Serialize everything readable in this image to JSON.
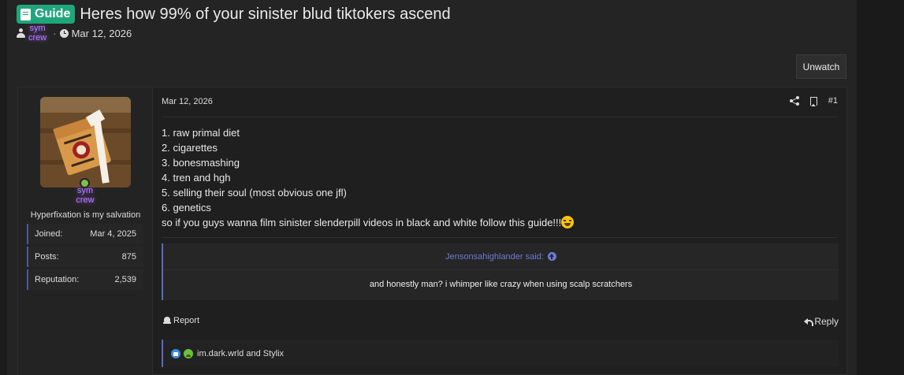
{
  "thread": {
    "badge_label": "Guide",
    "title": "Heres how 99% of your sinister blud tiktokers ascend",
    "author_line1": "sym",
    "author_line2": "crew",
    "separator": "·",
    "date": "Mar 12, 2026",
    "unwatch_label": "Unwatch"
  },
  "author": {
    "name_line1": "sym",
    "name_line2": "crew",
    "user_title": "Hyperfixation is my salvation",
    "online": true,
    "stats": [
      {
        "label": "Joined:",
        "value": "Mar 4, 2025"
      },
      {
        "label": "Posts:",
        "value": "875"
      },
      {
        "label": "Reputation:",
        "value": "2,539"
      }
    ]
  },
  "post": {
    "date": "Mar 12, 2026",
    "number": "#1",
    "lines": [
      "1. raw primal diet",
      "2. cigarettes",
      "3. bonesmashing",
      "4. tren and hgh",
      "5. selling their soul (most obvious one jfl)",
      "6. genetics"
    ],
    "closing": "so if you guys wanna film sinister slenderpill videos in black and white follow this guide!!!",
    "quote": {
      "author_said": "Jensonsahighlander said:",
      "text": "and honestly man? i whimper like crazy when using scalp scratchers"
    },
    "report_label": "Report",
    "reply_label": "Reply",
    "reactions_text": "im.dark.wrld and Stylix"
  },
  "colors": {
    "badge": "#1fa67a",
    "username_glow": "#b77cff",
    "quote_accent": "#6b7bd6",
    "online": "#7ec24a"
  }
}
